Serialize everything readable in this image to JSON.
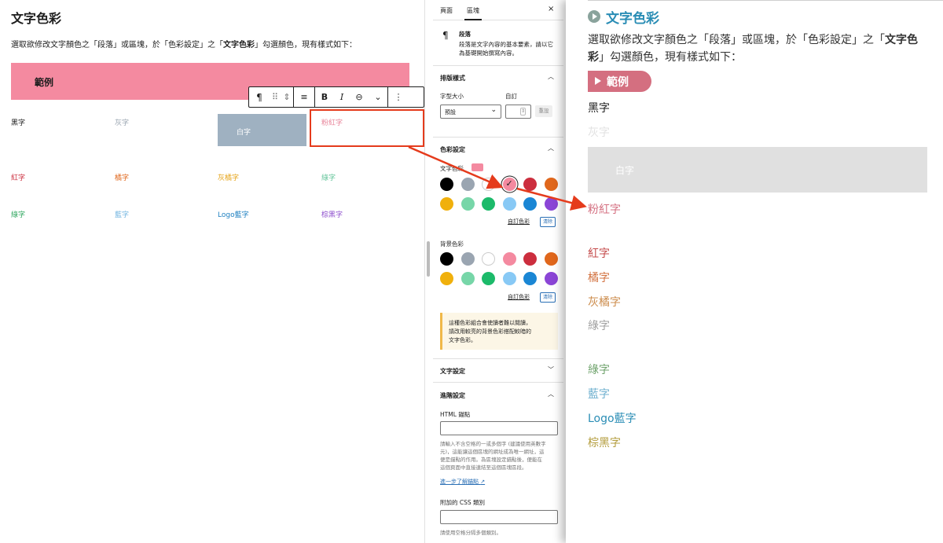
{
  "editor": {
    "title": "文字色彩",
    "desc_pre": "選取欲修改文字顏色之「段落」或區塊，於「色彩設定」之「",
    "desc_bold": "文字色彩",
    "desc_post": "」勾選顏色，現有樣式如下：",
    "example_label": "範例",
    "toolbar": {
      "paragraph": "¶",
      "drag": "⠿",
      "move": "⇕",
      "align": "≡",
      "bold": "B",
      "italic": "I",
      "link": "⊖",
      "more_chev": "⌄",
      "options": "⋮"
    },
    "cells": [
      {
        "text": "黑字",
        "color": "#1e1e1e"
      },
      {
        "text": "灰字",
        "color": "#9aa5b1"
      },
      {
        "text": "白字",
        "color": "#ffffff"
      },
      {
        "text": "粉紅字",
        "color": "#e8849a"
      },
      {
        "text": "紅字",
        "color": "#cc2e3e"
      },
      {
        "text": "橘字",
        "color": "#e0671c"
      },
      {
        "text": "灰橘字",
        "color": "#e6a419"
      },
      {
        "text": "綠字",
        "color": "#63c49a"
      },
      {
        "text": "綠字",
        "color": "#2ea65e"
      },
      {
        "text": "藍字",
        "color": "#74b6e0"
      },
      {
        "text": "Logo藍字",
        "color": "#1c7fc0"
      },
      {
        "text": "棕黑字",
        "color": "#8e4fcd"
      }
    ]
  },
  "sidebar": {
    "tab_page": "頁面",
    "tab_block": "區塊",
    "close": "×",
    "block_icon": "¶",
    "block_name": "段落",
    "block_desc_1": "段落是文字內容的基本要素，請以它",
    "block_desc_2": "為基礎開始撰寫內容。",
    "typography_head": "排版樣式",
    "font_size_label": "字型大小",
    "custom_label": "自訂",
    "font_size_value": "預設",
    "reset": "重設",
    "color_head": "色彩設定",
    "text_color_label": "文字色彩",
    "text_palette": [
      "#000000",
      "#9aa5b1",
      "#ffffff",
      "#f48aa0",
      "#cc2e3e",
      "#e0671c",
      "#f0b00c",
      "#77d6a8",
      "#1cba6a",
      "#88c9f5",
      "#1a86d4",
      "#8b45d6"
    ],
    "selected_index": 3,
    "custom_color": "自訂色彩",
    "clear": "清除",
    "bg_color_label": "背景色彩",
    "bg_palette": [
      "#000000",
      "#9aa5b1",
      "#ffffff",
      "#f48aa0",
      "#cc2e3e",
      "#e0671c",
      "#f0b00c",
      "#77d6a8",
      "#1cba6a",
      "#88c9f5",
      "#1a86d4",
      "#8b45d6"
    ],
    "contrast_warning": "這種色彩組合會使讀者難以閱讀，\n請改用較亮的背景色彩搭配較暗的\n文字色彩。",
    "text_settings_head": "文字設定",
    "advanced_head": "進階設定",
    "html_anchor_label": "HTML 錨點",
    "html_anchor_help": "請輸入不含空格的一或多個字 (建議使用英數字\n元)，這能讓這個區塊的網址成為唯一網址，這\n便是錨點的作用。為區塊設定錨點後，便能在\n這個頁面中直接連結至這個區塊區段。",
    "learn_more": "進一步了解錨點",
    "css_class_label": "附加的 CSS 類別",
    "css_class_help": "請使用空格分隔多個類別。"
  },
  "preview": {
    "title": "文字色彩",
    "desc_pre": "選取欲修改文字顏色之「段落」或區塊，於「色彩設定」之「",
    "desc_bold": "文字色彩",
    "desc_post": "」勾選顏色，現有樣式如下：",
    "example_label": "範例",
    "lines": [
      {
        "text": "黑字",
        "color": "#1e1e1e"
      },
      {
        "text": "灰字",
        "color": "#e2e2e2"
      },
      {
        "text": "白字",
        "color": "#ffffff"
      },
      {
        "text": "粉紅字",
        "color": "#d46f80"
      },
      {
        "text": "紅字",
        "color": "#c44a4a"
      },
      {
        "text": "橘字",
        "color": "#d2713f"
      },
      {
        "text": "灰橘字",
        "color": "#cc8c4c"
      },
      {
        "text": "綠字",
        "color": "#a0a0a0"
      },
      {
        "text": "綠字",
        "color": "#6fa36c"
      },
      {
        "text": "藍字",
        "color": "#6fb0cf"
      },
      {
        "text": "Logo藍字",
        "color": "#2a8db5"
      },
      {
        "text": "棕黑字",
        "color": "#b39c3c"
      }
    ]
  },
  "annotation_color": "#e53b1c"
}
